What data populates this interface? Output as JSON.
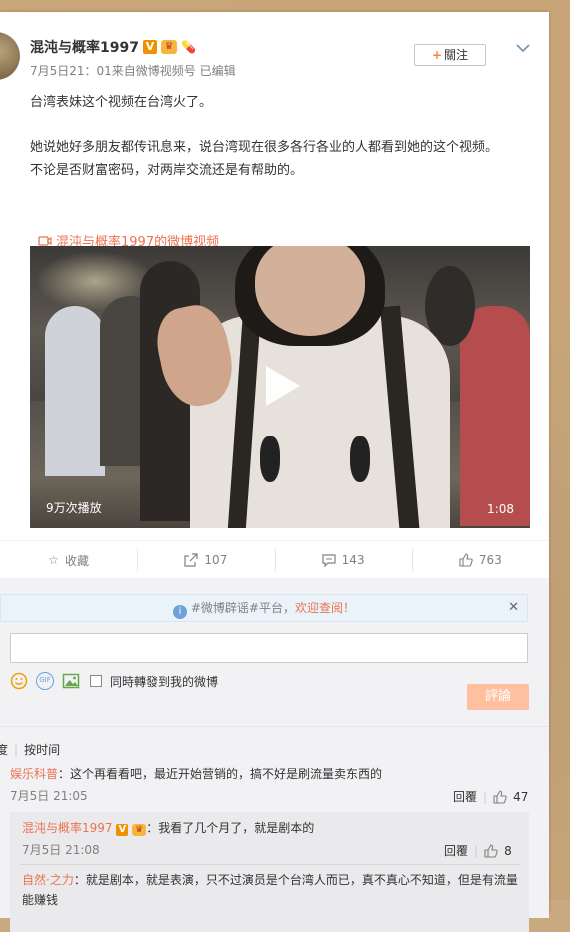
{
  "post": {
    "author": "混沌与概率1997",
    "badge_v": "V",
    "meta": "7月5日21：01来自微博视频号  已编辑",
    "follow_label": "關注",
    "text": [
      "台湾表妹这个视频在台湾火了。",
      "",
      "她说她好多朋友都传讯息来，说台湾现在很多各行各业的人都看到她的这个视频。",
      "不论是否财富密码，对两岸交流还是有帮助的。"
    ],
    "video_link": "混沌与概率1997的微博视频",
    "video": {
      "views": "9万次播放",
      "duration": "1:08"
    }
  },
  "actions": {
    "favorite": "收藏",
    "repost": "107",
    "comment": "143",
    "like": "763"
  },
  "comment_area": {
    "notice_prefix": "#微博辟谣#平台，",
    "notice_highlight": "欢迎查阅！",
    "tool_gif": "GIF",
    "repost_check_label": "同時轉發到我的微博",
    "submit_label": "評論",
    "sort_hot": "度",
    "sort_time": "按时间"
  },
  "comments": [
    {
      "user": "娱乐科普",
      "text": "：这个再看看吧，最近开始营销的，搞不好是刷流量卖东西的",
      "time": "7月5日 21:05",
      "reply_label": "回覆",
      "likes": "47"
    }
  ],
  "replies": [
    {
      "user": "混沌与概率1997",
      "text": "：我看了几个月了，就是剧本的",
      "time": "7月5日 21:08",
      "reply_label": "回覆",
      "likes": "8"
    },
    {
      "user": "自然·之力",
      "text": "：就是剧本，就是表演，只不过演员是个台湾人而已，真不真心不知道，但是有流量能赚钱"
    }
  ],
  "colors": {
    "accent": "#eb7350",
    "badge_orange": "#f29100",
    "submit_disabled": "#ffc09f"
  }
}
